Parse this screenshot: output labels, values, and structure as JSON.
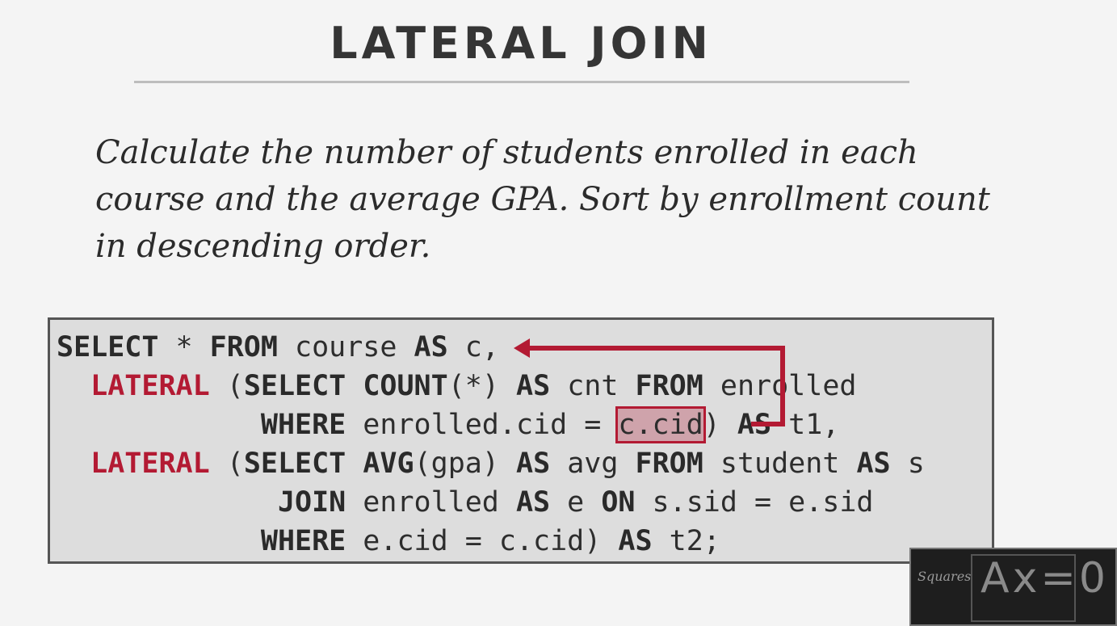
{
  "slide": {
    "title": "LATERAL JOIN",
    "description": "Calculate the number of students enrolled in each course and the average GPA. Sort by enrollment count in descending order.",
    "code_lines": [
      [
        {
          "t": "SELECT",
          "k": "kw"
        },
        {
          "t": " * "
        },
        {
          "t": "FROM",
          "k": "kw"
        },
        {
          "t": " course "
        },
        {
          "t": "AS",
          "k": "kw"
        },
        {
          "t": " c,"
        }
      ],
      [
        {
          "t": "  "
        },
        {
          "t": "LATERAL",
          "k": "lat"
        },
        {
          "t": " ("
        },
        {
          "t": "SELECT",
          "k": "kw"
        },
        {
          "t": " "
        },
        {
          "t": "COUNT",
          "k": "kw"
        },
        {
          "t": "(*) "
        },
        {
          "t": "AS",
          "k": "kw"
        },
        {
          "t": " cnt "
        },
        {
          "t": "FROM",
          "k": "kw"
        },
        {
          "t": " enrolled"
        }
      ],
      [
        {
          "t": "            "
        },
        {
          "t": "WHERE",
          "k": "kw"
        },
        {
          "t": " enrolled.cid = "
        },
        {
          "t": "c.cid",
          "k": "hl"
        },
        {
          "t": ") "
        },
        {
          "t": "AS",
          "k": "kw"
        },
        {
          "t": " t1,"
        }
      ],
      [
        {
          "t": "  "
        },
        {
          "t": "LATERAL",
          "k": "lat"
        },
        {
          "t": " ("
        },
        {
          "t": "SELECT",
          "k": "kw"
        },
        {
          "t": " "
        },
        {
          "t": "AVG",
          "k": "kw"
        },
        {
          "t": "(gpa) "
        },
        {
          "t": "AS",
          "k": "kw"
        },
        {
          "t": " avg "
        },
        {
          "t": "FROM",
          "k": "kw"
        },
        {
          "t": " student "
        },
        {
          "t": "AS",
          "k": "kw"
        },
        {
          "t": " s"
        }
      ],
      [
        {
          "t": "             "
        },
        {
          "t": "JOIN",
          "k": "kw"
        },
        {
          "t": " enrolled "
        },
        {
          "t": "AS",
          "k": "kw"
        },
        {
          "t": " e "
        },
        {
          "t": "ON",
          "k": "kw"
        },
        {
          "t": " s.sid = e.sid"
        }
      ],
      [
        {
          "t": "            "
        },
        {
          "t": "WHERE",
          "k": "kw"
        },
        {
          "t": " e.cid = c.cid) "
        },
        {
          "t": "AS",
          "k": "kw"
        },
        {
          "t": " t2;"
        }
      ]
    ],
    "accent_color": "#b31a33"
  },
  "webcam": {
    "chalk_left": "Squares",
    "chalk_main": "Ax=0"
  }
}
